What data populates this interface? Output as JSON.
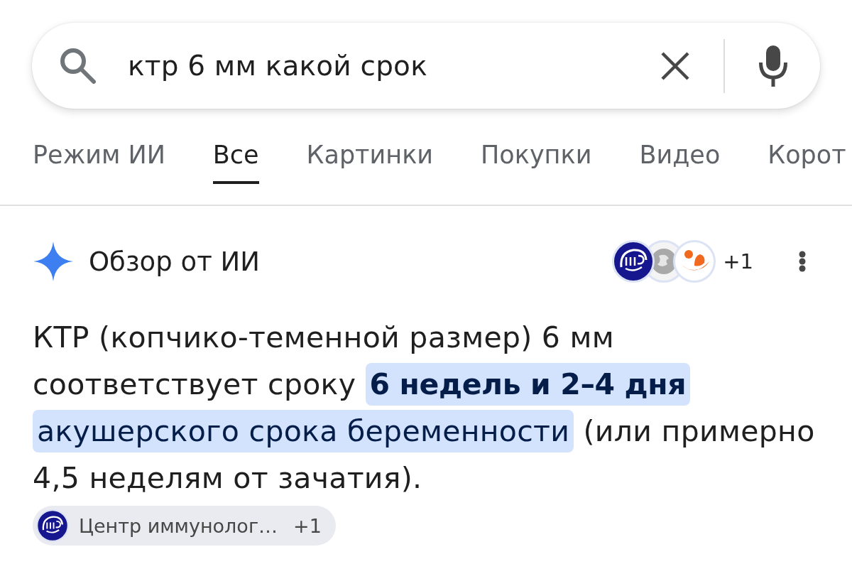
{
  "search": {
    "query": "ктр 6 мм какой срок"
  },
  "tabs": [
    {
      "label": "Режим ИИ",
      "selected": false
    },
    {
      "label": "Все",
      "selected": true
    },
    {
      "label": "Картинки",
      "selected": false
    },
    {
      "label": "Покупки",
      "selected": false
    },
    {
      "label": "Видео",
      "selected": false
    },
    {
      "label": "Корот",
      "selected": false
    }
  ],
  "ai_overview": {
    "title": "Обзор от ИИ",
    "sources_more": "+1",
    "text": [
      {
        "text": "КТР (копчико-теменной размер) 6 мм соответствует сроку",
        "highlighted": false
      },
      {
        "text": "**6 недель и 2–4 дня** акушерского срока беременности",
        "highlighted": true
      },
      {
        "text": "(или примерно 4,5 неделям от зачатия).",
        "highlighted": false
      }
    ],
    "citation": {
      "source": "Центр иммунолог…",
      "more": "+1"
    }
  }
}
